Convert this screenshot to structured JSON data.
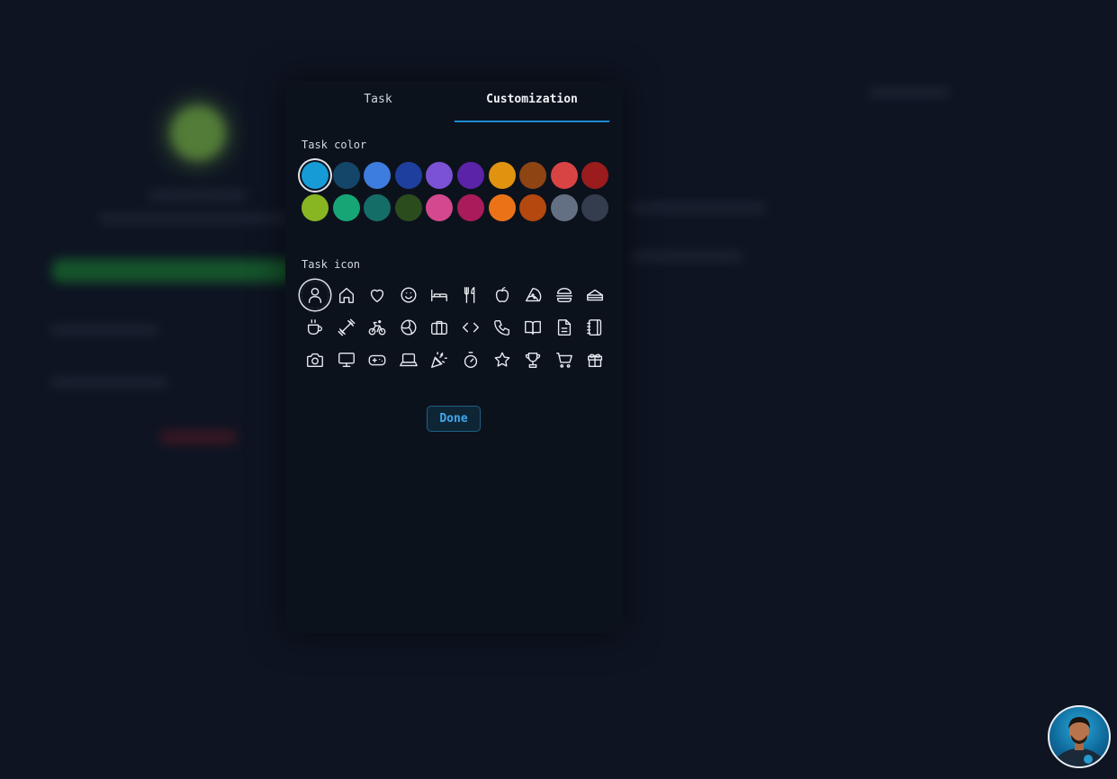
{
  "background": {
    "title": ""
  },
  "tabs": [
    {
      "label": "Task"
    },
    {
      "label": "Customization"
    }
  ],
  "active_tab": "Customization",
  "sections": {
    "color_label": "Task color",
    "icon_label": "Task icon"
  },
  "colors": [
    "#169bd6",
    "#14466a",
    "#3d7de0",
    "#1e3f9e",
    "#7b52d4",
    "#5a23a8",
    "#e0930f",
    "#8f4414",
    "#d84444",
    "#9a1c1c",
    "#88b623",
    "#16a676",
    "#156d68",
    "#2b4d1d",
    "#d4488f",
    "#aa1b5b",
    "#ea7318",
    "#b4480f",
    "#637083",
    "#333d4d"
  ],
  "selected_color": "#169bd6",
  "icons": [
    "user-icon",
    "home-icon",
    "heart-icon",
    "smile-icon",
    "bed-icon",
    "utensils-icon",
    "apple-icon",
    "pizza-icon",
    "burger-icon",
    "sandwich-icon",
    "coffee-icon",
    "dumbbell-icon",
    "bicycle-icon",
    "volleyball-icon",
    "briefcase-icon",
    "code-icon",
    "phone-icon",
    "book-icon",
    "document-icon",
    "notebook-icon",
    "camera-icon",
    "monitor-icon",
    "gamepad-icon",
    "laptop-icon",
    "party-popper-icon",
    "timer-icon",
    "star-icon",
    "trophy-icon",
    "cart-icon",
    "gift-icon"
  ],
  "selected_icon": "user-icon",
  "done_label": "Done"
}
